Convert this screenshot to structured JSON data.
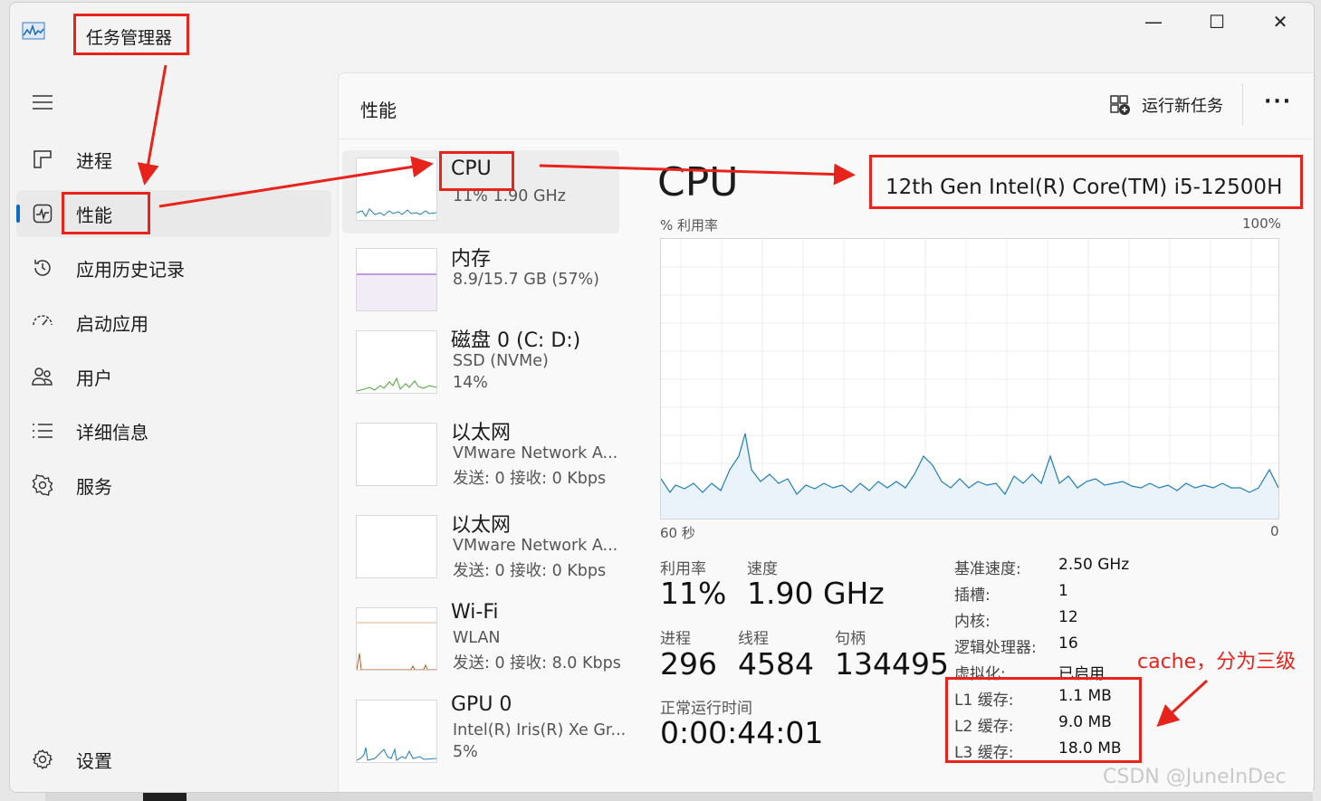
{
  "window": {
    "title": "任务管理器",
    "controls": [
      "minimize-icon",
      "maximize-icon",
      "close-icon"
    ]
  },
  "sidebar": {
    "items": [
      {
        "label": "进程",
        "icon": "processes-icon"
      },
      {
        "label": "性能",
        "icon": "performance-icon",
        "active": true
      },
      {
        "label": "应用历史记录",
        "icon": "history-icon"
      },
      {
        "label": "启动应用",
        "icon": "startup-icon"
      },
      {
        "label": "用户",
        "icon": "users-icon"
      },
      {
        "label": "详细信息",
        "icon": "details-icon"
      },
      {
        "label": "服务",
        "icon": "services-icon"
      }
    ],
    "settings_label": "设置"
  },
  "header": {
    "title": "性能",
    "run_task": "运行新任务"
  },
  "perf_list": [
    {
      "title": "CPU",
      "line1": "11% 1.90 GHz",
      "line2": "",
      "color": "#1f7ec1"
    },
    {
      "title": "内存",
      "line1": "8.9/15.7 GB (57%)",
      "line2": "",
      "color": "#8b3fbf"
    },
    {
      "title": "磁盘 0 (C: D:)",
      "line1": "SSD (NVMe)",
      "line2": "14%",
      "color": "#4ca834"
    },
    {
      "title": "以太网",
      "line1": "VMware Network A...",
      "line2": "发送: 0 接收: 0 Kbps",
      "color": "#b85a1c"
    },
    {
      "title": "以太网",
      "line1": "VMware Network A...",
      "line2": "发送: 0 接收: 0 Kbps",
      "color": "#b85a1c"
    },
    {
      "title": "Wi-Fi",
      "line1": "WLAN",
      "line2": "发送: 0 接收: 8.0 Kbps",
      "color": "#b85a1c"
    },
    {
      "title": "GPU 0",
      "line1": "Intel(R) Iris(R) Xe Gr...",
      "line2": "5%",
      "color": "#1f7ec1"
    }
  ],
  "cpu": {
    "title": "CPU",
    "processor": "12th Gen Intel(R) Core(TM) i5-12500H",
    "graph_label": "% 利用率",
    "graph_max": "100%",
    "graph_time": "60 秒",
    "graph_min": "0",
    "utilization_label": "利用率",
    "utilization": "11%",
    "speed_label": "速度",
    "speed": "1.90 GHz",
    "processes_label": "进程",
    "processes": "296",
    "threads_label": "线程",
    "threads": "4584",
    "handles_label": "句柄",
    "handles": "134495",
    "uptime_label": "正常运行时间",
    "uptime": "0:00:44:01",
    "specs": [
      {
        "k": "基准速度:",
        "v": "2.50 GHz"
      },
      {
        "k": "插槽:",
        "v": "1"
      },
      {
        "k": "内核:",
        "v": "12"
      },
      {
        "k": "逻辑处理器:",
        "v": "16"
      },
      {
        "k": "虚拟化:",
        "v": "已启用"
      },
      {
        "k": "L1 缓存:",
        "v": "1.1 MB"
      },
      {
        "k": "L2 缓存:",
        "v": "9.0 MB"
      },
      {
        "k": "L3 缓存:",
        "v": "18.0 MB"
      }
    ]
  },
  "annotation": "cache，分为三级",
  "watermark": "CSDN @JuneInDec",
  "colors": {
    "accent": "#0f6cbd",
    "annotation_red": "#e8231c",
    "cpu_line": "#1f7ec1"
  }
}
